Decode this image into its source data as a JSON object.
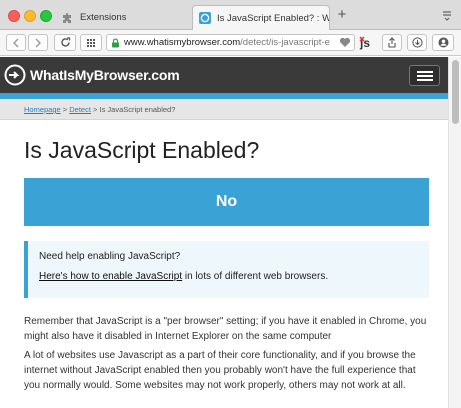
{
  "browser": {
    "tabs": [
      {
        "title": "Extensions",
        "active": false,
        "icon": "puzzle-icon"
      },
      {
        "title": "Is JavaScript Enabled? : What",
        "active": true,
        "icon": "whatismybrowser-favicon"
      }
    ],
    "url": {
      "host": "www.whatismybrowser.com",
      "path": "/detect/is-javascript-e"
    },
    "colors": {
      "tab_bar": "#dcdcdc",
      "toolbar": "#f6f6f6",
      "secure_lock": "#2f9e44"
    }
  },
  "site": {
    "logo_text": "WhatIsMyBrowser.com",
    "colors": {
      "header": "#3a3a3a",
      "accent": "#3ba2d5"
    }
  },
  "breadcrumb": {
    "home": "Homepage",
    "sep1": " > ",
    "detect": "Detect",
    "sep2": " > ",
    "current": "Is JavaScript enabled?"
  },
  "main": {
    "title": "Is JavaScript Enabled?",
    "result": "No",
    "help": {
      "question": "Need help enabling JavaScript?",
      "link": "Here's how to enable JavaScript",
      "suffix": " in lots of different web browsers."
    },
    "paragraphs": [
      "Remember that JavaScript is a \"per browser\" setting; if you have it enabled in Chrome, you might also have it disabled in Internet Explorer on the same computer",
      "A lot of websites use Javascript as a part of their core functionality, and if you browse the internet without JavaScript enabled then you probably won't have the full experience that you normally would. Some websites may not work properly, others may not work at all."
    ]
  }
}
